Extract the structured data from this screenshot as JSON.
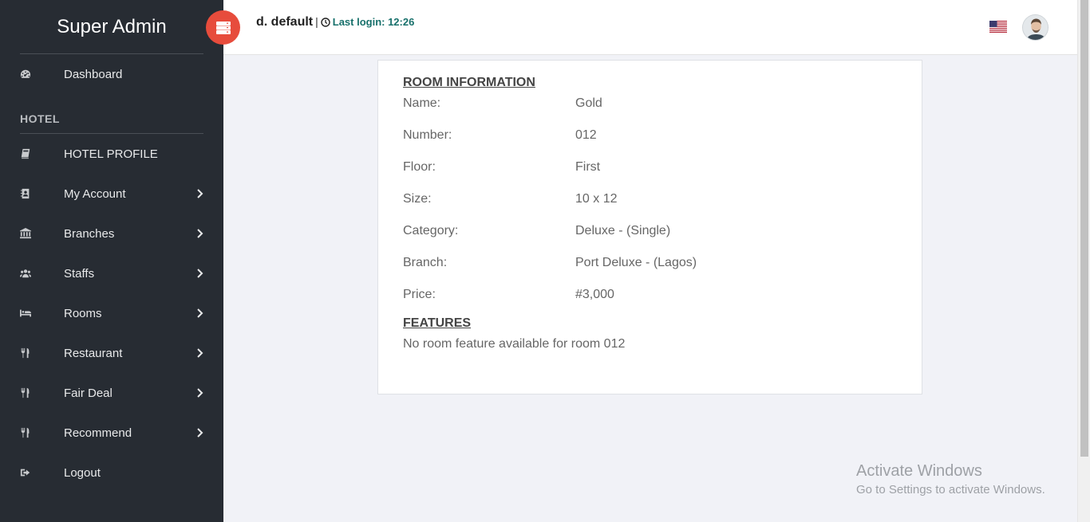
{
  "sidebar": {
    "brand": "Super Admin",
    "dashboard": "Dashboard",
    "section": "HOTEL",
    "items": [
      {
        "label": "HOTEL PROFILE",
        "icon": "book-icon",
        "chevron": false
      },
      {
        "label": "My Account",
        "icon": "contact-book-icon",
        "chevron": true
      },
      {
        "label": "Branches",
        "icon": "bank-icon",
        "chevron": true
      },
      {
        "label": "Staffs",
        "icon": "users-icon",
        "chevron": true
      },
      {
        "label": "Rooms",
        "icon": "bed-icon",
        "chevron": true
      },
      {
        "label": "Restaurant",
        "icon": "cutlery-icon",
        "chevron": true
      },
      {
        "label": "Fair Deal",
        "icon": "cutlery-icon",
        "chevron": true
      },
      {
        "label": "Recommend",
        "icon": "cutlery-icon",
        "chevron": true
      },
      {
        "label": "Logout",
        "icon": "sign-out-icon",
        "chevron": false
      }
    ]
  },
  "header": {
    "user": "d. default",
    "separator": "|",
    "last_login": "Last login: 12:26"
  },
  "room": {
    "title": "ROOM INFORMATION",
    "fields": [
      {
        "key": "Name:",
        "value": "Gold"
      },
      {
        "key": "Number:",
        "value": "012"
      },
      {
        "key": "Floor:",
        "value": "First"
      },
      {
        "key": "Size:",
        "value": "10 x 12"
      },
      {
        "key": "Category:",
        "value": "Deluxe - (Single)"
      },
      {
        "key": "Branch:",
        "value": "Port Deluxe - (Lagos)"
      },
      {
        "key": "Price:",
        "value": "#3,000"
      }
    ],
    "features_title": "FEATURES",
    "features_empty": "No room feature available for room 012"
  },
  "watermark": {
    "line1": "Activate Windows",
    "line2": "Go to Settings to activate Windows."
  },
  "colors": {
    "sidebar_bg": "#272c33",
    "toggle_bg": "#e74c3c",
    "last_login": "#17706b",
    "page_bg": "#f1f2f7"
  }
}
